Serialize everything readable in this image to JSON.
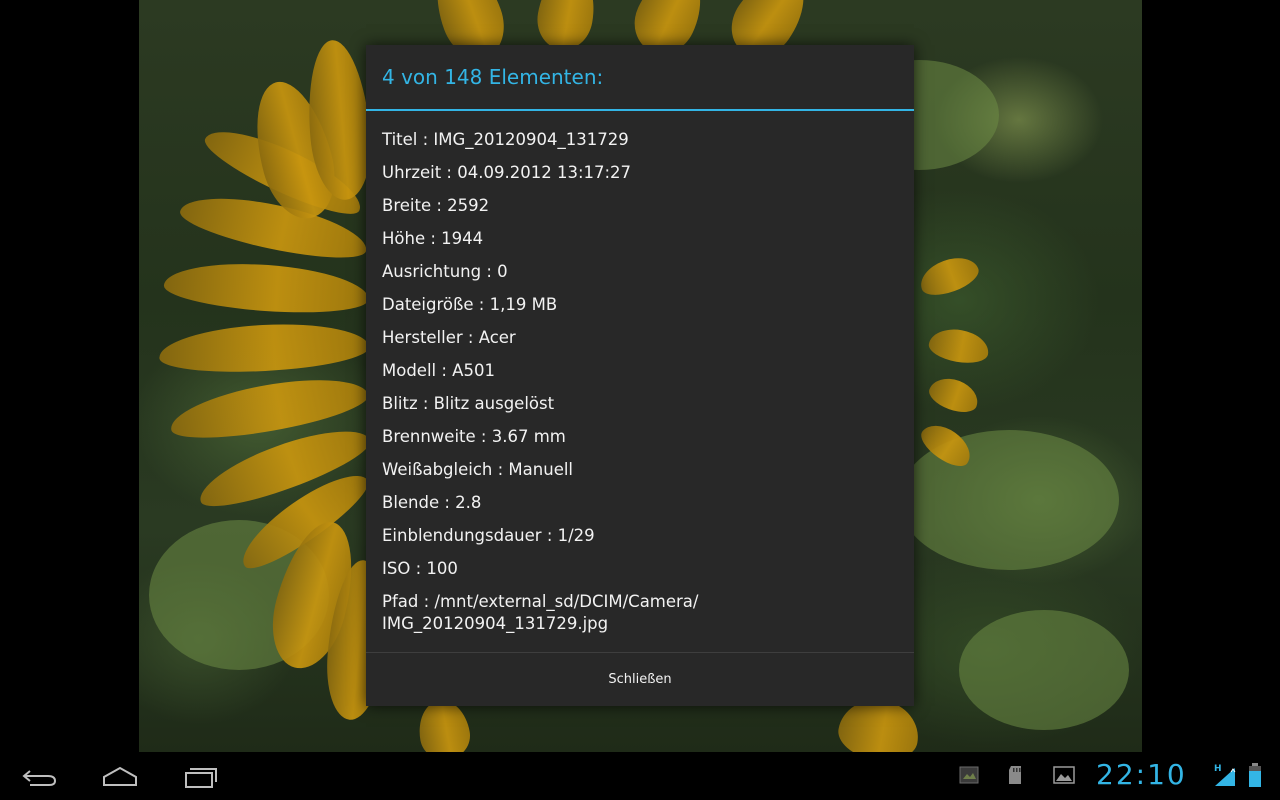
{
  "dialog": {
    "title": "4 von 148 Elementen:",
    "details": [
      "Titel : IMG_20120904_131729",
      "Uhrzeit : 04.09.2012 13:17:27",
      "Breite : 2592",
      "Höhe : 1944",
      "Ausrichtung : 0",
      "Dateigröße : 1,19 MB",
      "Hersteller : Acer",
      "Modell : A501",
      "Blitz : Blitz ausgelöst",
      "Brennweite : 3.67 mm",
      "Weißabgleich : Manuell",
      "Blende : 2.8",
      "Einblendungsdauer : 1/29",
      "ISO : 100",
      "Pfad : /mnt/external_sd/DCIM/Camera/ IMG_20120904_131729.jpg"
    ],
    "close_label": "Schließen"
  },
  "system_bar": {
    "clock": "22:10",
    "nav": [
      "back-icon",
      "home-icon",
      "recent-apps-icon"
    ],
    "status_icons": [
      "photo-notification-icon",
      "sd-card-icon",
      "gallery-icon",
      "signal-icon",
      "battery-icon"
    ]
  },
  "colors": {
    "accent": "#33b5e5",
    "dialog_bg": "#282828",
    "text": "#f2f2f2"
  }
}
